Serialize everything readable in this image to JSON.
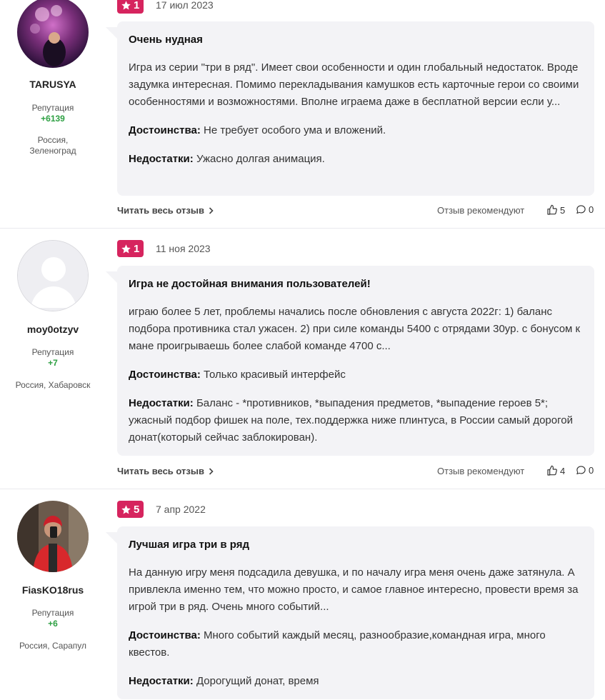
{
  "reviews": [
    {
      "author": "TARUSYA",
      "reputation_label": "Репутация",
      "reputation": "+6139",
      "location": "Россия, Зеленоград",
      "rating": "1",
      "date": "17 июл 2023",
      "title": "Очень нудная",
      "text": "Игра из серии \"три в ряд\". Имеет свои особенности и один глобальный недостаток. Вроде задумка интересная. Помимо перекладывания камушков есть карточные герои со своими особенностями и возможностями. Вполне играема даже в бесплатной версии если у...",
      "pros_label": "Достоинства:",
      "pros": "Не требует особого ума и вложений.",
      "cons_label": "Недостатки:",
      "cons": "Ужасно долгая анимация.",
      "read_full": "Читать весь отзыв",
      "recommend": "Отзыв рекомендуют",
      "likes": "5",
      "comments": "0"
    },
    {
      "author": "moy0otzyv",
      "reputation_label": "Репутация",
      "reputation": "+7",
      "location": "Россия, Хабаровск",
      "rating": "1",
      "date": "11 ноя 2023",
      "title": "Игра не достойная внимания пользователей!",
      "text": "играю более 5 лет, проблемы начались после обновления с августа 2022г: 1) баланс подбора противника стал ужасен. 2) при силе команды 5400 с отрядами 30ур. с бонусом к мане проигрываешь более слабой команде 4700 с...",
      "pros_label": "Достоинства:",
      "pros": "Только красивый интерфейс",
      "cons_label": "Недостатки:",
      "cons": "Баланс - *противников, *выпадения предметов, *выпадение героев 5*; ужасный подбор фишек на поле, тех.поддержка ниже плинтуса, в России самый дорогой донат(который сейчас заблокирован).",
      "read_full": "Читать весь отзыв",
      "recommend": "Отзыв рекомендуют",
      "likes": "4",
      "comments": "0"
    },
    {
      "author": "FiasKO18rus",
      "reputation_label": "Репутация",
      "reputation": "+6",
      "location": "Россия, Сарапул",
      "rating": "5",
      "date": "7 апр 2022",
      "title": "Лучшая игра три в ряд",
      "text": "На данную игру меня подсадила девушка, и по началу игра меня очень даже затянула. А привлекла именно тем, что можно просто, и самое главное интересно, провести время за игрой три в ряд. Очень много событий...",
      "pros_label": "Достоинства:",
      "pros": "Много событий каждый месяц, разнообразие,командная игра, много квестов.",
      "cons_label": "Недостатки:",
      "cons": "Дорогущий донат, время"
    }
  ],
  "colors": {
    "badge": "#d6245e",
    "reputation": "#2ea043",
    "bubble": "#f3f3f6"
  }
}
